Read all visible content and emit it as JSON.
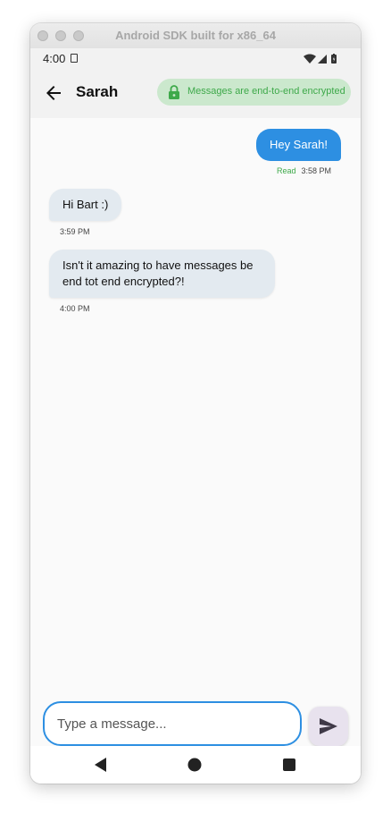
{
  "window": {
    "title": "Android SDK built for x86_64"
  },
  "status_bar": {
    "time": "4:00"
  },
  "app_bar": {
    "contact_name": "Sarah",
    "encryption_badge": "Messages are end-to-end encrypted"
  },
  "messages": [
    {
      "direction": "outgoing",
      "text": "Hey Sarah!",
      "status": "Read",
      "time": "3:58 PM"
    },
    {
      "direction": "incoming",
      "text": "Hi Bart :)",
      "time": "3:59 PM"
    },
    {
      "direction": "incoming",
      "text": "Isn't it amazing to have messages be end tot end encrypted?!",
      "time": "4:00 PM"
    }
  ],
  "composer": {
    "placeholder": "Type a message...",
    "value": ""
  },
  "icons": {
    "back": "arrow-left-icon",
    "lock": "lock-icon",
    "send": "send-icon",
    "nav": [
      "triangle-back-icon",
      "circle-home-icon",
      "square-recents-icon"
    ]
  },
  "colors": {
    "accent_blue": "#2d8fe2",
    "badge_green_bg": "#cbe8cd",
    "badge_green_text": "#3ea94a",
    "incoming_bubble": "#e3eaf0",
    "send_button_bg": "#e8e2ee"
  }
}
